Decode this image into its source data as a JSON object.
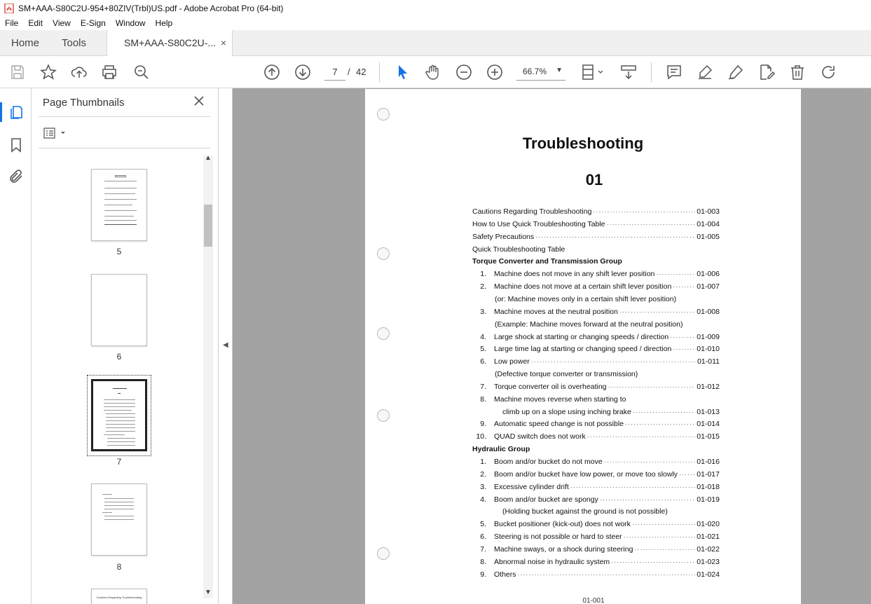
{
  "window": {
    "title": "SM+AAA-S80C2U-954+80ZIV(Trbl)US.pdf - Adobe Acrobat Pro (64-bit)"
  },
  "menu": [
    "File",
    "Edit",
    "View",
    "E-Sign",
    "Window",
    "Help"
  ],
  "tabs": {
    "home": "Home",
    "tools": "Tools",
    "doc": "SM+AAA-S80C2U-...",
    "doc_close": "×"
  },
  "toolbar": {
    "current_page": "7",
    "page_sep": "/",
    "total_pages": "42",
    "zoom": "66.7%",
    "icons": [
      "save-icon",
      "star-icon",
      "upload-icon",
      "print-icon",
      "find-icon",
      "prev-page-icon",
      "next-page-icon",
      "select-cursor-icon",
      "hand-icon",
      "zoom-out-icon",
      "zoom-in-icon",
      "fit-page-icon",
      "scroll-mode-icon",
      "comment-icon",
      "highlight-icon",
      "sign-icon",
      "edit-icon",
      "delete-icon",
      "rotate-icon"
    ]
  },
  "sidebar": {
    "title": "Page Thumbnails",
    "thumbnails": [
      {
        "label": "5"
      },
      {
        "label": "6"
      },
      {
        "label": "7",
        "selected": true
      },
      {
        "label": "8"
      }
    ],
    "thumb9_caption": "Cautions Regarding Troubleshooting"
  },
  "document": {
    "title": "Troubleshooting",
    "section": "01",
    "footer": "01-001",
    "toc": [
      {
        "text": "Cautions Regarding Troubleshooting",
        "page": "01-003",
        "indent": 0
      },
      {
        "text": "How to Use Quick Troubleshooting Table",
        "page": "01-004",
        "indent": 0
      },
      {
        "text": "Safety Precautions",
        "page": "01-005",
        "indent": 0
      },
      {
        "text": "Quick Troubleshooting Table",
        "page": "",
        "indent": 0
      },
      {
        "text": "Torque Converter and Transmission Group",
        "page": "",
        "indent": 0,
        "bold": true
      },
      {
        "num": "1.",
        "text": "Machine does not move in any shift lever position",
        "page": "01-006",
        "indent": 1
      },
      {
        "num": "2.",
        "text": "Machine does not move at a certain shift lever position",
        "page": "01-007",
        "indent": 1
      },
      {
        "text": "(or: Machine moves only in a certain shift lever position)",
        "page": "",
        "indent": 2
      },
      {
        "num": "3.",
        "text": "Machine moves at the neutral position",
        "page": "01-008",
        "indent": 1
      },
      {
        "text": "(Example: Machine moves forward at the neutral position)",
        "page": "",
        "indent": 2
      },
      {
        "num": "4.",
        "text": "Large shock at starting or changing speeds / direction",
        "page": "01-009",
        "indent": 1
      },
      {
        "num": "5.",
        "text": "Large time lag at starting or changing speed / direction",
        "page": "01-010",
        "indent": 1
      },
      {
        "num": "6.",
        "text": "Low power",
        "page": "01-011",
        "indent": 1
      },
      {
        "text": "(Defective torque converter or transmission)",
        "page": "",
        "indent": 2
      },
      {
        "num": "7.",
        "text": "Torque converter oil is overheating",
        "page": "01-012",
        "indent": 1
      },
      {
        "num": "8.",
        "text": "Machine moves reverse when starting to",
        "page": "",
        "indent": 1
      },
      {
        "text": "climb up on a slope using inching brake",
        "page": "01-013",
        "indent": 3
      },
      {
        "num": "9.",
        "text": "Automatic speed change is not possible",
        "page": "01-014",
        "indent": 1
      },
      {
        "num": "10.",
        "text": "QUAD switch does not work",
        "page": "01-015",
        "indent": 1
      },
      {
        "text": "Hydraulic Group",
        "page": "",
        "indent": 0,
        "bold": true
      },
      {
        "num": "1.",
        "text": "Boom and/or bucket do not move",
        "page": "01-016",
        "indent": 4
      },
      {
        "num": "2.",
        "text": "Boom and/or bucket have low power, or move too slowly",
        "page": "01-017",
        "indent": 4
      },
      {
        "num": "3.",
        "text": "Excessive cylinder drift",
        "page": "01-018",
        "indent": 4
      },
      {
        "num": "4.",
        "text": "Boom and/or bucket are spongy",
        "page": "01-019",
        "indent": 4
      },
      {
        "text": "(Holding bucket against the ground is not possible)",
        "page": "",
        "indent": 5
      },
      {
        "num": "5.",
        "text": "Bucket positioner (kick-out) does not work",
        "page": "01-020",
        "indent": 4
      },
      {
        "num": "6.",
        "text": "Steering is not possible or hard to steer",
        "page": "01-021",
        "indent": 4
      },
      {
        "num": "7.",
        "text": "Machine sways, or a shock during steering",
        "page": "01-022",
        "indent": 4
      },
      {
        "num": "8.",
        "text": "Abnormal noise in hydraulic system",
        "page": "01-023",
        "indent": 4
      },
      {
        "num": "9.",
        "text": "Others",
        "page": "01-024",
        "indent": 4
      }
    ]
  },
  "colors": {
    "accent": "#1473e6",
    "doc_bg": "#a3a3a3",
    "icon": "#555555",
    "pdf_red": "#d42a1e"
  }
}
